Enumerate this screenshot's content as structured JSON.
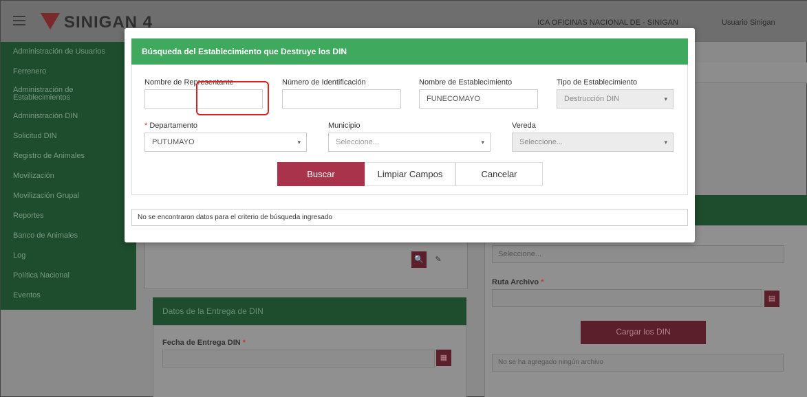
{
  "app": {
    "logo_text": "SINIGAN 4",
    "top_right_org": "ICA OFICINAS NACIONAL DE - SINIGAN",
    "top_right_user": "Usuario Sinigan"
  },
  "sidebar": {
    "items": [
      {
        "label": "Administración de Usuarios"
      },
      {
        "label": "Ferrenero"
      },
      {
        "label": "Administración de"
      },
      {
        "label": "Establecimientos"
      },
      {
        "label": "Administración DIN"
      },
      {
        "label": "Solicitud DIN"
      },
      {
        "label": "Registro de Animales"
      },
      {
        "label": "Movilización"
      },
      {
        "label": "Movilización Grupal"
      },
      {
        "label": "Reportes"
      },
      {
        "label": "Banco de Animales"
      },
      {
        "label": "Log"
      },
      {
        "label": "Política Nacional"
      },
      {
        "label": "Eventos"
      }
    ]
  },
  "background": {
    "left_section_header": "Datos de la Entrega de DIN",
    "date_label": "Fecha de Entrega DIN",
    "select_placeholder": "Seleccione...",
    "file_label": "Ruta Archivo",
    "upload_button": "Cargar los DIN",
    "no_files_msg": "No se ha agregado ningún archivo"
  },
  "modal": {
    "title": "Búsqueda del Establecimiento que Destruye los DIN",
    "fields": {
      "rep_name_label": "Nombre de Representante",
      "rep_name_value": "",
      "id_number_label": "Número de Identificación",
      "id_number_value": "",
      "est_name_label": "Nombre de Establecimiento",
      "est_name_value": "FUNECOMAYO",
      "est_type_label": "Tipo de Establecimiento",
      "est_type_value": "Destrucción DIN",
      "dept_required": "*",
      "dept_label": "Departamento",
      "dept_value": "PUTUMAYO",
      "muni_label": "Municipio",
      "muni_value": "Seleccione...",
      "vereda_label": "Vereda",
      "vereda_value": "Seleccione..."
    },
    "buttons": {
      "search": "Buscar",
      "clear": "Limpiar Campos",
      "cancel": "Cancelar"
    },
    "result_message": "No se encontraron datos para el criterio de búsqueda ingresado"
  },
  "icons": {
    "caret": "▾",
    "search": "🔍",
    "calendar": "▦",
    "file": "▤",
    "user": "👤"
  },
  "colors": {
    "header_green": "#3fa95e",
    "primary_button": "#a8334a",
    "highlight": "#e02020"
  }
}
